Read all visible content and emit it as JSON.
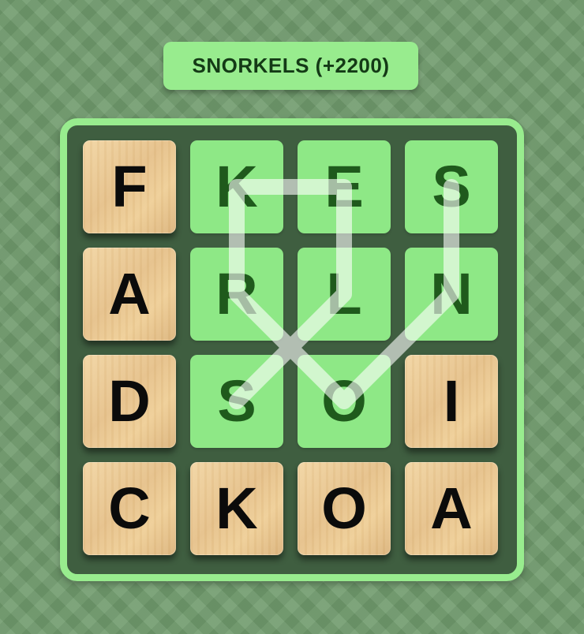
{
  "found_word": "SNORKELS (+2200)",
  "board": {
    "rows": [
      [
        {
          "letter": "F",
          "state": "wood"
        },
        {
          "letter": "K",
          "state": "selected"
        },
        {
          "letter": "E",
          "state": "selected"
        },
        {
          "letter": "S",
          "state": "selected"
        }
      ],
      [
        {
          "letter": "A",
          "state": "wood"
        },
        {
          "letter": "R",
          "state": "selected"
        },
        {
          "letter": "L",
          "state": "selected"
        },
        {
          "letter": "N",
          "state": "selected"
        }
      ],
      [
        {
          "letter": "D",
          "state": "wood"
        },
        {
          "letter": "S",
          "state": "selected"
        },
        {
          "letter": "O",
          "state": "selected"
        },
        {
          "letter": "I",
          "state": "wood"
        }
      ],
      [
        {
          "letter": "C",
          "state": "wood"
        },
        {
          "letter": "K",
          "state": "wood"
        },
        {
          "letter": "O",
          "state": "wood"
        },
        {
          "letter": "A",
          "state": "wood"
        }
      ]
    ],
    "path": [
      [
        0,
        3
      ],
      [
        1,
        3
      ],
      [
        2,
        2
      ],
      [
        1,
        1
      ],
      [
        0,
        1
      ],
      [
        0,
        2
      ],
      [
        1,
        2
      ],
      [
        2,
        1
      ]
    ]
  },
  "colors": {
    "background": "#6f9a6c",
    "highlight": "#98ec8e",
    "selected_tile": "#8ee886",
    "selected_letter": "#1f5a1c",
    "wood_tile": "#e6c28c",
    "board_inner": "#3f5e40"
  }
}
